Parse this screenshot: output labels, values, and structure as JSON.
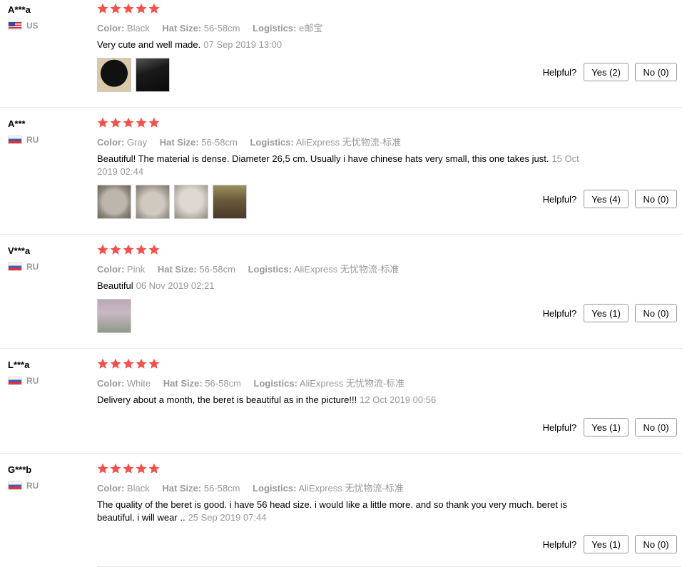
{
  "labels": {
    "color": "Color:",
    "hat_size": "Hat Size:",
    "logistics": "Logistics:",
    "helpful": "Helpful?"
  },
  "colors": {
    "star": "#f5514c",
    "muted": "#999999",
    "border": "#999999"
  },
  "reviews": [
    {
      "user": "A***a",
      "country": "US",
      "flag": "us-flag-icon",
      "stars": 5,
      "color": "Black",
      "hat_size": "56-58cm",
      "logistics": "e邮宝",
      "text": "Very cute and well made.",
      "date": "07 Sep 2019 13:00",
      "photos": 2,
      "yes": "Yes (2)",
      "no": "No (0)"
    },
    {
      "user": "A***",
      "country": "RU",
      "flag": "ru-flag-icon",
      "stars": 5,
      "color": "Gray",
      "hat_size": "56-58cm",
      "logistics": "AliExpress 无忧物流-标准",
      "text": "Beautiful! The material is dense. Diameter 26,5 cm. Usually i have chinese hats very small, this one takes just.",
      "date": "15 Oct 2019 02:44",
      "photos": 4,
      "yes": "Yes (4)",
      "no": "No (0)"
    },
    {
      "user": "V***a",
      "country": "RU",
      "flag": "ru-flag-icon",
      "stars": 5,
      "color": "Pink",
      "hat_size": "56-58cm",
      "logistics": "AliExpress 无忧物流-标准",
      "text": "Beautiful",
      "date": "06 Nov 2019 02:21",
      "photos": 1,
      "yes": "Yes (1)",
      "no": "No (0)"
    },
    {
      "user": "L***a",
      "country": "RU",
      "flag": "ru-flag-icon",
      "stars": 5,
      "color": "White",
      "hat_size": "56-58cm",
      "logistics": "AliExpress 无忧物流-标准",
      "text": "Delivery about a month, the beret is beautiful as in the picture!!!",
      "date": "12 Oct 2019 00:56",
      "photos": 0,
      "yes": "Yes (1)",
      "no": "No (0)"
    },
    {
      "user": "G***b",
      "country": "RU",
      "flag": "ru-flag-icon",
      "stars": 5,
      "color": "Black",
      "hat_size": "56-58cm",
      "logistics": "AliExpress 无忧物流-标准",
      "text": "The quality of the beret is good. i have 56 head size. i would like a little more. and so thank you very much. beret is beautiful. i will wear ..",
      "date": "25 Sep 2019 07:44",
      "photos": 0,
      "yes": "Yes (1)",
      "no": "No (0)"
    }
  ]
}
